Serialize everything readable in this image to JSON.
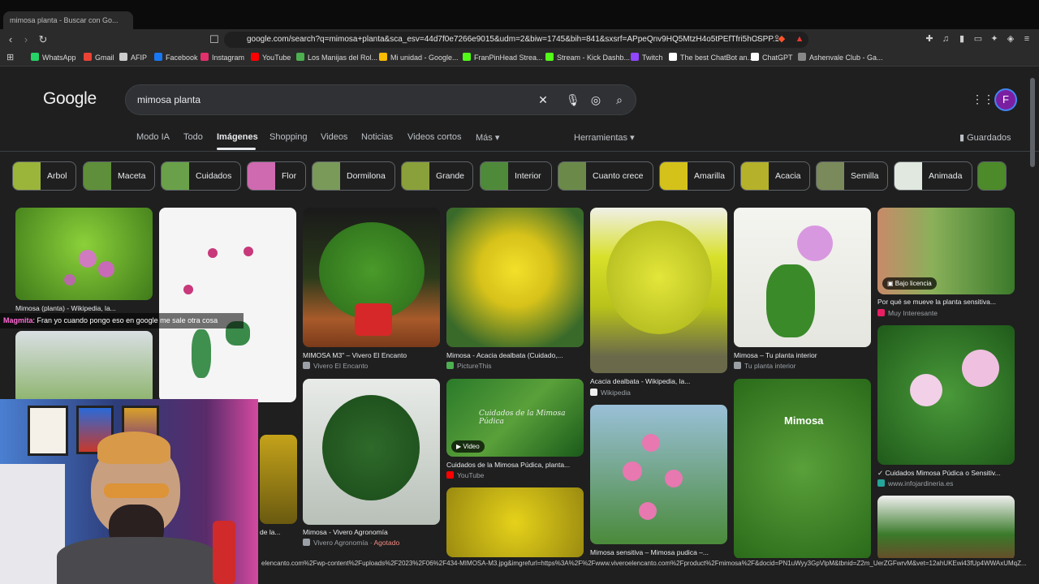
{
  "browser": {
    "tab_title": "mimosa planta - Buscar con Go...",
    "url": "google.com/search?q=mimosa+planta&sca_esv=44d7f0e7266e9015&udm=2&biw=1745&bih=841&sxsrf=APpeQnv9HQ5MtzH4o5tPEfTfri5hCSPP..."
  },
  "bookmarks": [
    {
      "label": "WhatsApp",
      "color": "#25d366"
    },
    {
      "label": "Gmail",
      "color": "#ea4335"
    },
    {
      "label": "AFIP",
      "color": "#cccccc"
    },
    {
      "label": "Facebook",
      "color": "#1877f2"
    },
    {
      "label": "Instagram",
      "color": "#e1306c"
    },
    {
      "label": "YouTube",
      "color": "#ff0000"
    },
    {
      "label": "Los Manijas del Rol...",
      "color": "#4caf50"
    },
    {
      "label": "Mi unidad - Google...",
      "color": "#fbbc04"
    },
    {
      "label": "FranPinHead Strea...",
      "color": "#53fc18"
    },
    {
      "label": "Stream - Kick Dashb...",
      "color": "#53fc18"
    },
    {
      "label": "Twitch",
      "color": "#9146ff"
    },
    {
      "label": "The best ChatBot an...",
      "color": "#ffffff"
    },
    {
      "label": "ChatGPT",
      "color": "#ffffff"
    },
    {
      "label": "Ashenvale Club - Ga...",
      "color": "#888888"
    }
  ],
  "google": {
    "logo": "Google",
    "query": "mimosa planta",
    "avatar_letter": "F",
    "tabs": [
      "Modo IA",
      "Todo",
      "Imágenes",
      "Shopping",
      "Videos",
      "Noticias",
      "Videos cortos",
      "Más"
    ],
    "tools": "Herramientas",
    "saved": "Guardados"
  },
  "chips": [
    {
      "label": "Arbol",
      "color": "#9bb53a"
    },
    {
      "label": "Maceta",
      "color": "#5f8f3a"
    },
    {
      "label": "Cuidados",
      "color": "#6aa04a"
    },
    {
      "label": "Flor",
      "color": "#d06ab0"
    },
    {
      "label": "Dormilona",
      "color": "#7a9a5a"
    },
    {
      "label": "Grande",
      "color": "#8aa03a"
    },
    {
      "label": "Interior",
      "color": "#4f8a3a"
    },
    {
      "label": "Cuanto crece",
      "color": "#6b8a4a"
    },
    {
      "label": "Amarilla",
      "color": "#d4c21a"
    },
    {
      "label": "Acacia",
      "color": "#b5b12a"
    },
    {
      "label": "Semilla",
      "color": "#7a8a5a"
    },
    {
      "label": "Animada",
      "color": "#e0e8e0"
    }
  ],
  "results": [
    {
      "caption": "Mimosa (planta) - Wikipedia, la...",
      "source": ""
    },
    {
      "caption": "MIMOSA M3\" – Vivero El Encanto",
      "source": "Vivero El Encanto"
    },
    {
      "caption": "Mimosa - Acacia dealbata (Cuidado,...",
      "source": "PictureThis"
    },
    {
      "caption": "Acacia dealbata - Wikipedia, la...",
      "source": "Wikipedia"
    },
    {
      "caption": "Mimosa – Tu planta interior",
      "source": "Tu planta interior"
    },
    {
      "caption": "Por qué se mueve la planta sensitiva...",
      "source": "Muy Interesante",
      "badge": "Bajo licencia"
    },
    {
      "caption": "Mimosa - Vivero Agronomía",
      "source": "Vivero Agronomía",
      "extra": "Agotado"
    },
    {
      "caption": "Cuidados de la Mimosa Púdica, planta...",
      "source": "YouTube",
      "badge": "Video"
    },
    {
      "caption": "Mimosa sensitiva – Mimosa pudica –...",
      "source": ""
    },
    {
      "caption": "✓ Cuidados Mimosa Púdica o Sensitiv...",
      "source": "www.infojardineria.es"
    },
    {
      "caption": "de la...",
      "source": ""
    }
  ],
  "image_text": {
    "mimosa_label": "Mimosa",
    "pudica_watermark": "Cuidados de la Mimosa Púdica"
  },
  "overlay": {
    "chat_user": "Magmita",
    "chat_text": ": Fran yo cuando pongo eso en google me sale otra cosa"
  },
  "status_url": "elencanto.com%2Fwp-content%2Fuploads%2F2023%2F06%2F434-MIMOSA-M3.jpg&imgrefurl=https%3A%2F%2Fwww.viveroelencanto.com%2Fproduct%2Fmimosa%2F&docid=PN1uWyy3GpVlpM&tbnid=Z2m_UerZGFwrvM&vet=12ahUKEwi43fUp4WWAxUMqZ..."
}
